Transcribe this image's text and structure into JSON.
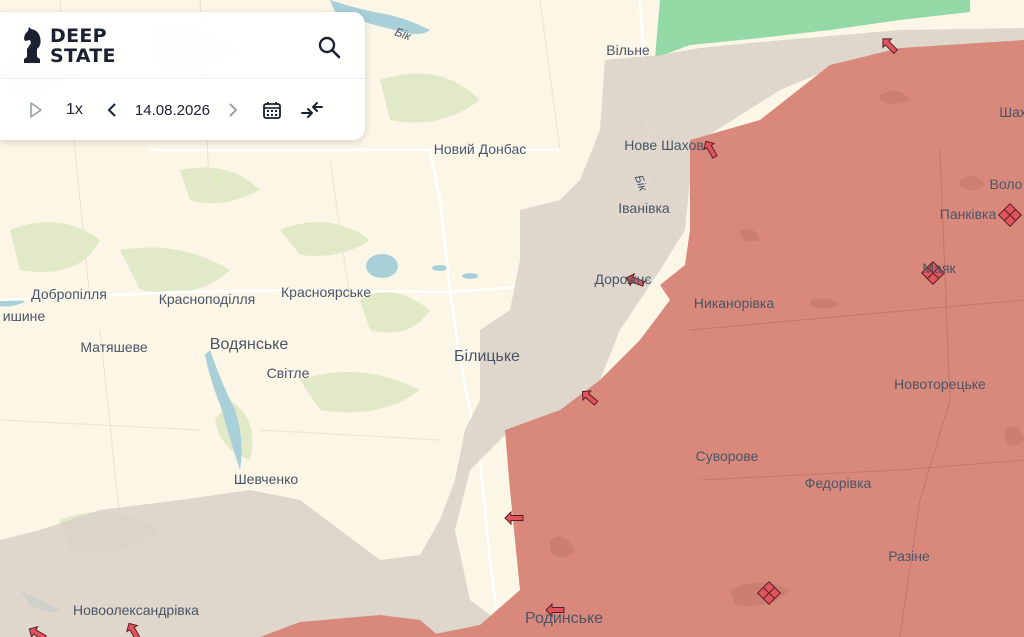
{
  "app": {
    "logo_line1": "DEEP",
    "logo_line2": "STATE"
  },
  "controls": {
    "speed": "1x",
    "date": "14.08.2026"
  },
  "river_label": "Бік",
  "settlements": [
    {
      "id": "vilne",
      "name": "Вільне"
    },
    {
      "id": "shakh",
      "name": "Шах"
    },
    {
      "id": "nove-shakhove",
      "name": "Нове Шахов"
    },
    {
      "id": "novyi-donbas",
      "name": "Новий Донбас"
    },
    {
      "id": "volod",
      "name": "Воло"
    },
    {
      "id": "ivanivka",
      "name": "Іванівка"
    },
    {
      "id": "pankivka",
      "name": "Панківка"
    },
    {
      "id": "mayak",
      "name": "Маяк"
    },
    {
      "id": "dorozhnie",
      "name": "Дорожнє"
    },
    {
      "id": "dobropillia",
      "name": "Добропілля"
    },
    {
      "id": "krasnopodillia",
      "name": "Краснoподілля"
    },
    {
      "id": "krasnoiarske",
      "name": "Красноярське"
    },
    {
      "id": "nykanorivka",
      "name": "Никанорівка"
    },
    {
      "id": "shyne",
      "name": "ишине"
    },
    {
      "id": "matiasheve",
      "name": "Матяшеве"
    },
    {
      "id": "vodianske",
      "name": "Водянське"
    },
    {
      "id": "bilytske",
      "name": "Білицьке"
    },
    {
      "id": "svitle",
      "name": "Світле"
    },
    {
      "id": "novotoretske",
      "name": "Новоторецьке"
    },
    {
      "id": "suvorove",
      "name": "Суворове"
    },
    {
      "id": "fedorivka",
      "name": "Федорівка"
    },
    {
      "id": "shevchenko",
      "name": "Шевченко"
    },
    {
      "id": "razine",
      "name": "Разіне"
    },
    {
      "id": "novooleksandrivka",
      "name": "Новоолександрівка"
    },
    {
      "id": "rodynske",
      "name": "Родинське"
    }
  ],
  "colors": {
    "background": "#fbf6e6",
    "occupied": "#d9897c",
    "contested": "#d8d0c6",
    "liberated": "#7fd39a",
    "water": "#a9cfd8",
    "vegetation": "#dfe8c4",
    "arrow": "#e0545e"
  }
}
